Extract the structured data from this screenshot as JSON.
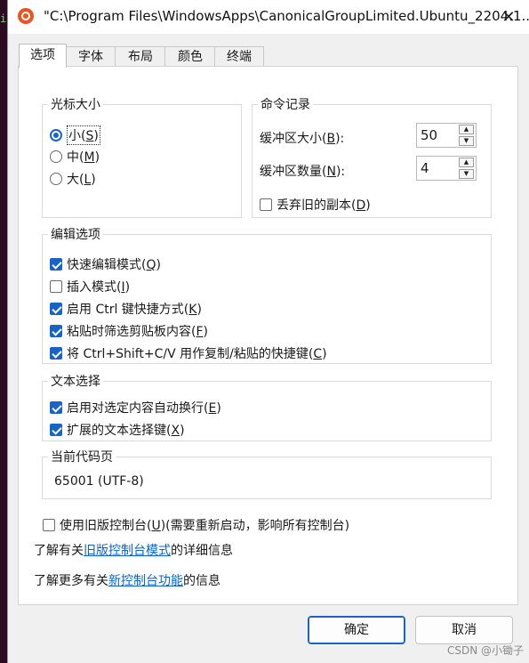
{
  "terminal": {
    "glyph": "i"
  },
  "window": {
    "title": "\"C:\\Program Files\\WindowsApps\\CanonicalGroupLimited.Ubuntu_2204.1...."
  },
  "tabs": [
    {
      "label": "选项",
      "active": true
    },
    {
      "label": "字体",
      "active": false
    },
    {
      "label": "布局",
      "active": false
    },
    {
      "label": "颜色",
      "active": false
    },
    {
      "label": "终端",
      "active": false
    }
  ],
  "cursor_size": {
    "title": "光标大小",
    "options": [
      {
        "label": "小(",
        "key": "S",
        "suffix": ")",
        "checked": true
      },
      {
        "label": "中(",
        "key": "M",
        "suffix": ")",
        "checked": false
      },
      {
        "label": "大(",
        "key": "L",
        "suffix": ")",
        "checked": false
      }
    ]
  },
  "history": {
    "title": "命令记录",
    "buffer_size_label": "缓冲区大小(",
    "buffer_size_key": "B",
    "buffer_size_suffix": "):",
    "buffer_size_value": "50",
    "buffer_count_label": "缓冲区数量(",
    "buffer_count_key": "N",
    "buffer_count_suffix": "):",
    "buffer_count_value": "4",
    "discard_label": "丢弃旧的副本(",
    "discard_key": "D",
    "discard_suffix": ")",
    "discard_checked": false
  },
  "edit_options": {
    "title": "编辑选项",
    "items": [
      {
        "label": "快速编辑模式(",
        "key": "Q",
        "suffix": ")",
        "checked": true
      },
      {
        "label": "插入模式(",
        "key": "I",
        "suffix": ")",
        "checked": false
      },
      {
        "label": "启用 Ctrl 键快捷方式(",
        "key": "K",
        "suffix": ")",
        "checked": true
      },
      {
        "label": "粘贴时筛选剪贴板内容(",
        "key": "F",
        "suffix": ")",
        "checked": true
      },
      {
        "label": "将 Ctrl+Shift+C/V 用作复制/粘贴的快捷键(",
        "key": "C",
        "suffix": ")",
        "checked": true
      }
    ]
  },
  "text_selection": {
    "title": "文本选择",
    "items": [
      {
        "label": "启用对选定内容自动换行(",
        "key": "E",
        "suffix": ")",
        "checked": true
      },
      {
        "label": "扩展的文本选择键(",
        "key": "X",
        "suffix": ")",
        "checked": true
      }
    ]
  },
  "codepage": {
    "title": "当前代码页",
    "value": "65001 (UTF-8)"
  },
  "legacy": {
    "label": "使用旧版控制台(",
    "key": "U",
    "suffix": ")(需要重新启动，影响所有控制台)",
    "checked": false
  },
  "info1": {
    "prefix": "了解有关",
    "link": "旧版控制台模式",
    "suffix": "的详细信息"
  },
  "info2": {
    "prefix": "了解更多有关",
    "link": "新控制台功能",
    "suffix": "的信息"
  },
  "buttons": {
    "ok": "确定",
    "cancel": "取消"
  },
  "watermark": "CSDN @小锄子",
  "colors": {
    "accent": "#1764c6",
    "link": "#0a64c8",
    "ubuntu": "#e95420"
  }
}
